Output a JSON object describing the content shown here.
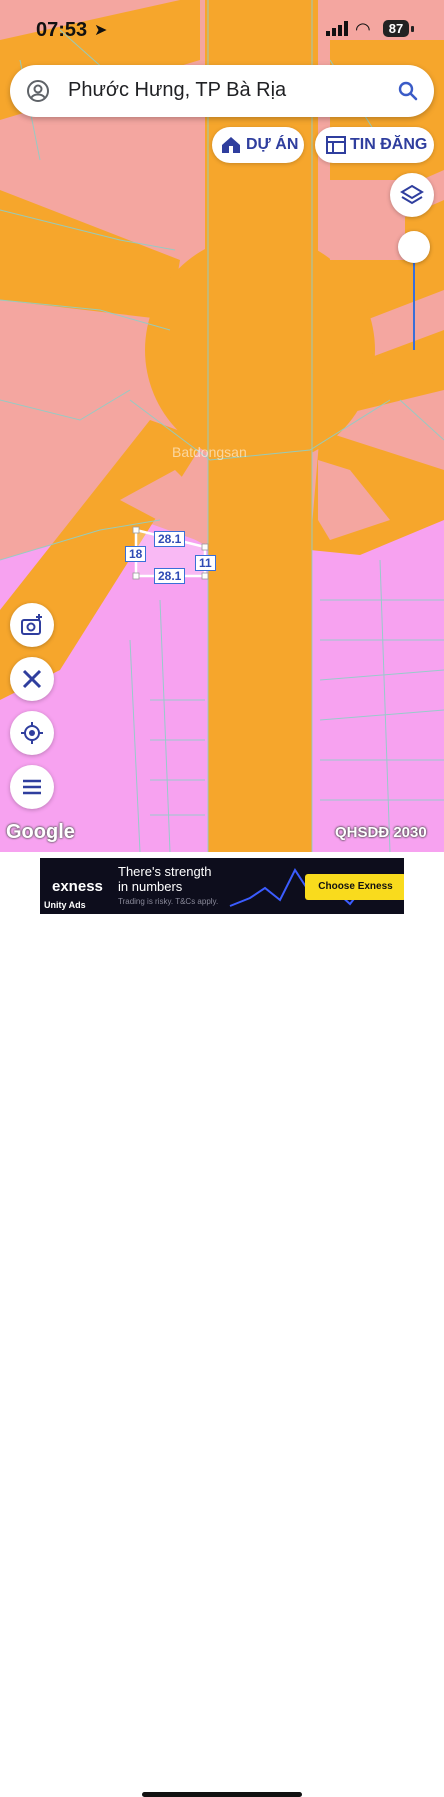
{
  "status_bar": {
    "time": "07:53",
    "battery": "87"
  },
  "search": {
    "query": "Phước Hưng, TP Bà Rịa"
  },
  "filters": {
    "du_an": "DỰ ÁN",
    "tin_dang": "TIN ĐĂNG"
  },
  "plot": {
    "top": "28.1",
    "bottom": "28.1",
    "left": "18",
    "right": "11"
  },
  "map": {
    "watermark": "Batdongsan",
    "attribution": "Google",
    "layer_label": "QHSDĐ 2030"
  },
  "ad": {
    "brand": "exness",
    "headline_1": "There's strength",
    "headline_2": "in numbers",
    "risk": "Trading is risky. T&Cs apply.",
    "cta": "Choose Exness",
    "network": "Unity Ads"
  },
  "colors": {
    "road": "#f6a62c",
    "residential": "#f4a6a0",
    "commercial": "#f7a2f0",
    "accent": "#2f3e9e"
  }
}
